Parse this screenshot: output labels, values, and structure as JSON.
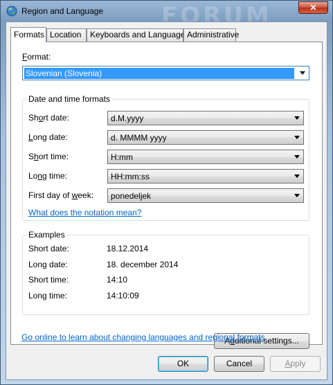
{
  "window": {
    "title": "Region and Language",
    "background_text": "FORUM",
    "close_glyph": "✕"
  },
  "tabs": [
    {
      "label": "Formats",
      "active": true
    },
    {
      "label": "Location",
      "active": false
    },
    {
      "label": "Keyboards and Languages",
      "active": false
    },
    {
      "label": "Administrative",
      "active": false
    }
  ],
  "format": {
    "label_first": "F",
    "label_rest": "ormat:",
    "value": "Slovenian (Slovenia)"
  },
  "date_time_formats": {
    "title": "Date and time formats",
    "rows": [
      {
        "label_pre": "Sh",
        "label_u": "o",
        "label_post": "rt date:",
        "value": "d.M.yyyy"
      },
      {
        "label_pre": "",
        "label_u": "L",
        "label_post": "ong date:",
        "value": "d. MMMM yyyy"
      },
      {
        "label_pre": "S",
        "label_u": "h",
        "label_post": "ort time:",
        "value": "H:mm"
      },
      {
        "label_pre": "Lo",
        "label_u": "n",
        "label_post": "g time:",
        "value": "HH:mm:ss"
      },
      {
        "label_pre": "First day of ",
        "label_u": "w",
        "label_post": "eek:",
        "value": "ponedeljek"
      }
    ],
    "notation_link": "What does the notation mean?"
  },
  "examples": {
    "title": "Examples",
    "rows": [
      {
        "label": "Short date:",
        "value": "18.12.2014"
      },
      {
        "label": "Long date:",
        "value": "18. december 2014"
      },
      {
        "label": "Short time:",
        "value": "14:10"
      },
      {
        "label": "Long time:",
        "value": "14:10:09"
      }
    ]
  },
  "additional_settings_pre": "A",
  "additional_settings_u": "d",
  "additional_settings_post": "ditional settings...",
  "online_link": "Go online to learn about changing languages and regional formats",
  "buttons": {
    "ok": "OK",
    "cancel": "Cancel",
    "apply_u": "A",
    "apply_rest": "pply"
  },
  "colors": {
    "link": "#0066cc",
    "selection": "#3399ff",
    "close": "#c7503b"
  }
}
